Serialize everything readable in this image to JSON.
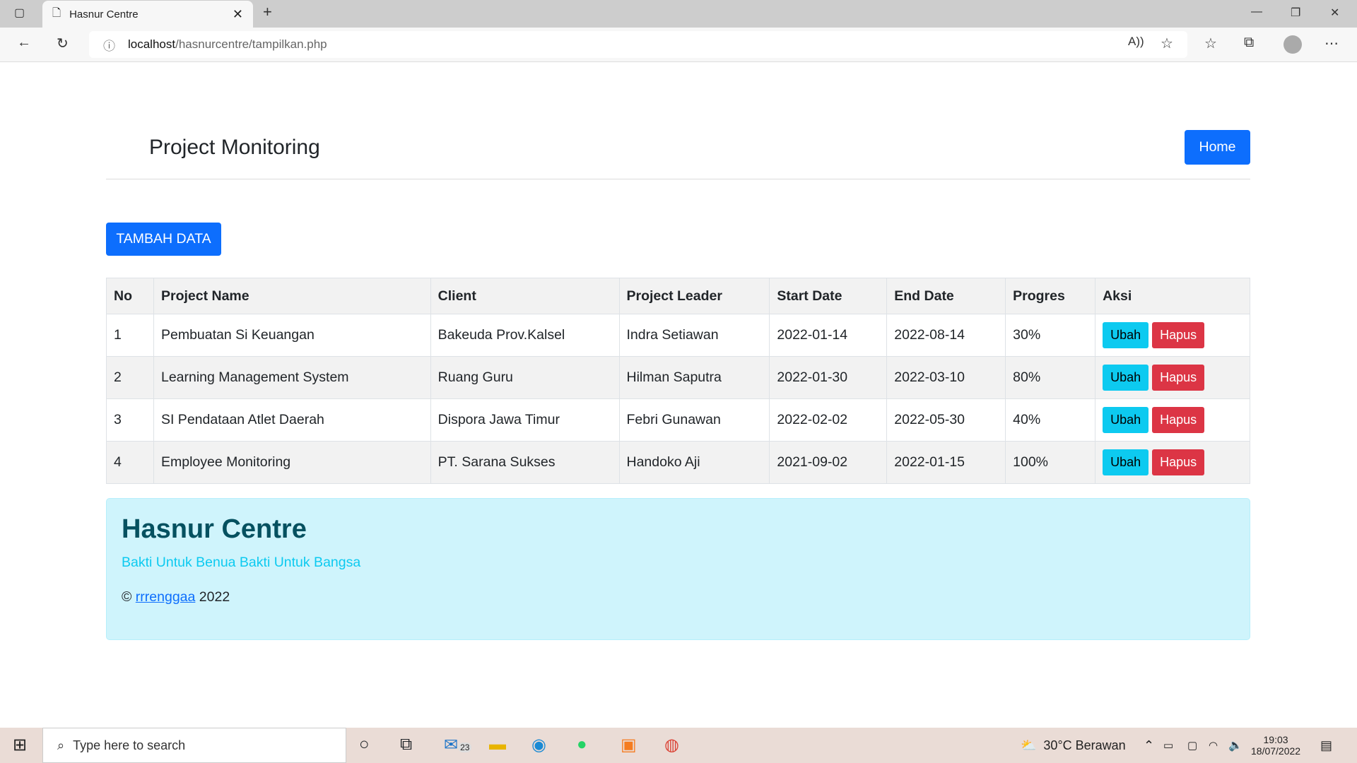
{
  "browser": {
    "tab_title": "Hasnur Centre",
    "url_host": "localhost",
    "url_path": "/hasnurcentre/tampilkan.php"
  },
  "header": {
    "title": "Project Monitoring",
    "home_label": "Home"
  },
  "add_button": "TAMBAH DATA",
  "table": {
    "columns": [
      "No",
      "Project Name",
      "Client",
      "Project Leader",
      "Start Date",
      "End Date",
      "Progres",
      "Aksi"
    ],
    "rows": [
      {
        "no": "1",
        "name": "Pembuatan Si Keuangan",
        "client": "Bakeuda Prov.Kalsel",
        "leader": "Indra Setiawan",
        "start": "2022-01-14",
        "end": "2022-08-14",
        "progress": "30%"
      },
      {
        "no": "2",
        "name": "Learning Management System",
        "client": "Ruang Guru",
        "leader": "Hilman Saputra",
        "start": "2022-01-30",
        "end": "2022-03-10",
        "progress": "80%"
      },
      {
        "no": "3",
        "name": "SI Pendataan Atlet Daerah",
        "client": "Dispora Jawa Timur",
        "leader": "Febri Gunawan",
        "start": "2022-02-02",
        "end": "2022-05-30",
        "progress": "40%"
      },
      {
        "no": "4",
        "name": "Employee Monitoring",
        "client": "PT. Sarana Sukses",
        "leader": "Handoko Aji",
        "start": "2021-09-02",
        "end": "2022-01-15",
        "progress": "100%"
      }
    ],
    "edit_label": "Ubah",
    "delete_label": "Hapus"
  },
  "footer": {
    "title": "Hasnur Centre",
    "tagline": "Bakti Untuk Benua Bakti Untuk Bangsa",
    "copy_symbol": "©",
    "author": "rrrenggaa",
    "year": "2022"
  },
  "taskbar": {
    "search_placeholder": "Type here to search",
    "mail_badge": "23",
    "weather": "30°C  Berawan",
    "time": "19:03",
    "date": "18/07/2022"
  }
}
